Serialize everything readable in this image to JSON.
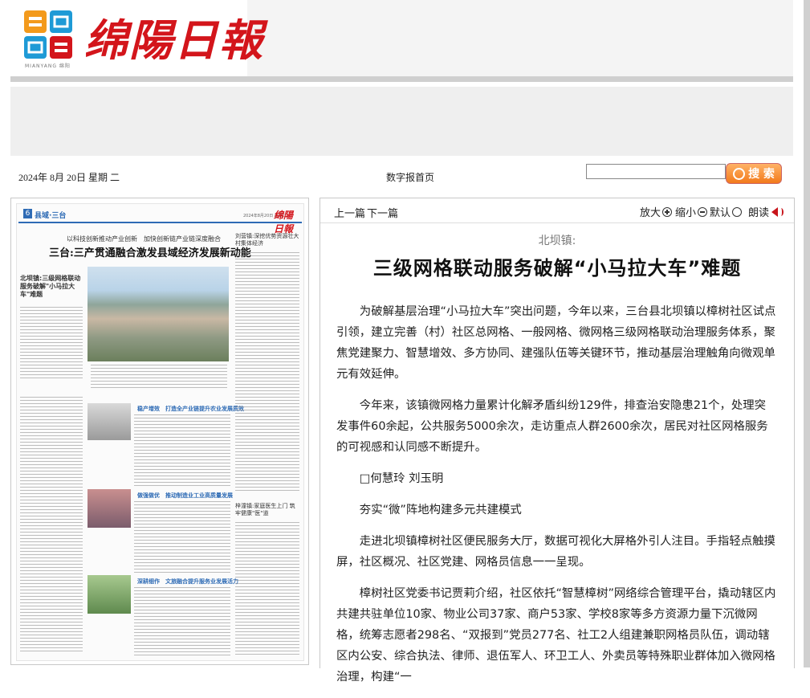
{
  "header": {
    "logo_caption": "MIANYANG 绵阳",
    "masthead": "绵陽日報"
  },
  "datebar": {
    "date": "2024年 8月 20日 星期 二",
    "home_link": "数字报首页",
    "search_placeholder": "",
    "search_button": "搜 索"
  },
  "paper": {
    "page_number": "6",
    "section": "县域·三台",
    "date_line": "2024年8月20日 星期二",
    "mast": "绵陽日報",
    "kicker": "以科技创新推动产业创新　加快创新链产业链深度融合",
    "headline": "三台:三产贯通融合激发县域经济发展新动能",
    "side_head": "北坝镇:三级网格联动服务破解\"小马拉大车\"难题",
    "sub_heads": [
      "稳产增效　打造全产业链提升农业发展质效",
      "做强做优　推动制造业工业高质量发展",
      "深耕细作　文旅融合提升服务业发展活力"
    ],
    "right_box_title": "刘营镇:深挖优势资源壮大村集体经济",
    "right_box2_title": "梓潼镇:家庭医生上门 筑牢健康\"医\"道"
  },
  "article": {
    "toolbar": {
      "prev": "上一篇",
      "next": "下一篇",
      "zoom_in": "放大",
      "zoom_out": "缩小",
      "default": "默认",
      "read_aloud": "朗读"
    },
    "kicker": "北坝镇:",
    "title": "三级网格联动服务破解“小马拉大车”难题",
    "paragraphs": [
      "为破解基层治理“小马拉大车”突出问题，今年以来，三台县北坝镇以樟树社区试点引领，建立完善（村）社区总网格、一般网格、微网格三级网格联动治理服务体系，聚焦党建聚力、智慧增效、多方协同、建强队伍等关键环节，推动基层治理触角向微观单元有效延伸。",
      "今年来，该镇微网格力量累计化解矛盾纠纷129件，排查治安隐患21个，处理突发事件60余起，公共服务5000余次，走访重点人群2600余次，居民对社区网格服务的可视感和认同感不断提升。",
      "□何慧玲 刘玉明",
      "夯实“微”阵地构建多元共建模式",
      "走进北坝镇樟树社区便民服务大厅，数据可视化大屏格外引人注目。手指轻点触摸屏，社区概况、社区党建、网格员信息一一呈现。",
      "樟树社区党委书记贾莉介绍，社区依托“智慧樟树”网络综合管理平台，撬动辖区内共建共驻单位10家、物业公司37家、商户53家、学校8家等多方资源力量下沉微网格，统筹志愿者298名、“双报到”党员277名、社工2人组建兼职网格员队伍，调动辖区内公安、综合执法、律师、退伍军人、环卫工人、外卖员等特殊职业群体加入微网格治理，构建“一"
    ]
  }
}
